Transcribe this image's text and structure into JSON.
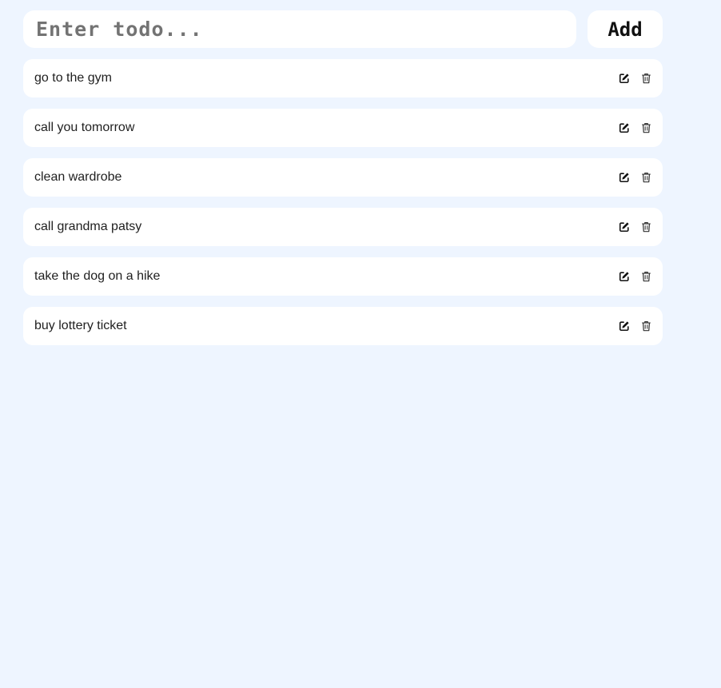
{
  "input": {
    "placeholder": "Enter todo...",
    "value": ""
  },
  "add_button": {
    "label": "Add"
  },
  "todos": [
    {
      "text": "go to the gym",
      "edit_icon": "edit-icon",
      "delete_icon": "trash-icon"
    },
    {
      "text": "call you tomorrow",
      "edit_icon": "edit-icon",
      "delete_icon": "trash-icon"
    },
    {
      "text": "clean wardrobe",
      "edit_icon": "edit-icon",
      "delete_icon": "trash-icon"
    },
    {
      "text": "call grandma patsy",
      "edit_icon": "edit-icon",
      "delete_icon": "trash-icon"
    },
    {
      "text": "take the dog on a hike",
      "edit_icon": "edit-icon",
      "delete_icon": "trash-icon"
    },
    {
      "text": "buy lottery ticket",
      "edit_icon": "edit-icon",
      "delete_icon": "trash-icon"
    }
  ],
  "colors": {
    "background": "#eef5ff",
    "card": "#ffffff",
    "text": "#1f1f1f",
    "placeholder": "#737373"
  }
}
